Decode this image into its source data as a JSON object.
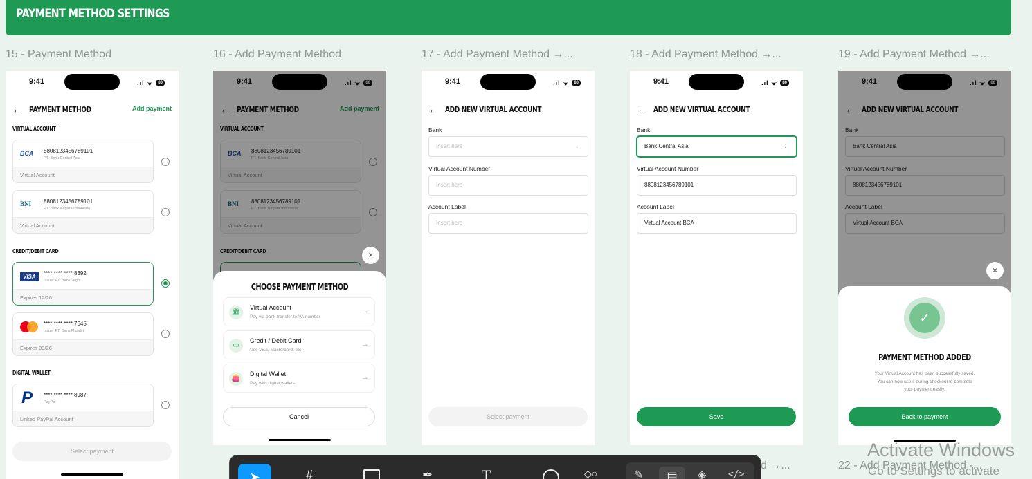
{
  "banner": {
    "title": "PAYMENT METHOD SETTINGS"
  },
  "frames": {
    "f15": {
      "label": "15 - Payment Method"
    },
    "f16": {
      "label": "16 - Add Payment Method"
    },
    "f17": {
      "label": "17 - Add Payment Method →..."
    },
    "f18": {
      "label": "18 - Add Payment Method →..."
    },
    "f19": {
      "label": "19 - Add Payment Method →..."
    },
    "f21": {
      "label": "d →..."
    },
    "f22": {
      "label": "22 - Add Payment Method -..."
    }
  },
  "status": {
    "time": "9:41",
    "signal": ".ıl ᯤ",
    "battery": "80"
  },
  "screen15": {
    "back": "←",
    "title": "PAYMENT METHOD",
    "action": "Add payment",
    "section_va": "VIRTUAL ACCOUNT",
    "section_card": "CREDIT/DEBIT CARD",
    "section_wallet": "DIGITAL WALLET",
    "cards": [
      {
        "logo": "BCA",
        "number": "8808123456789101",
        "sub": "PT. Bank Central Asia",
        "footer": "Virtual Account"
      },
      {
        "logo": "BNI",
        "number": "8808123456789101",
        "sub": "PT. Bank Negara Indonesia",
        "footer": "Virtual Account"
      },
      {
        "logo": "VISA",
        "number": "**** **** **** 8392",
        "sub": "Issuer PT. Bank Jago",
        "footer": "Expires 12/26"
      },
      {
        "logo": "mastercard",
        "number": "**** **** **** 7645",
        "sub": "Issuer PT. Bank Mandiri",
        "footer": "Expires 09/26"
      },
      {
        "logo": "P",
        "number": "**** **** **** 8987",
        "sub": "PayPal",
        "footer": "Linked PayPal Account"
      }
    ],
    "button": "Select payment"
  },
  "screen16": {
    "sheet_title": "CHOOSE PAYMENT METHOD",
    "close": "×",
    "options": [
      {
        "name": "Virtual Account",
        "desc": "Pay via bank transfer to VA number",
        "icon": "🏛"
      },
      {
        "name": "Credit / Debit Card",
        "desc": "Use Visa, Mastercard, etc.",
        "icon": "▭"
      },
      {
        "name": "Digital Wallet",
        "desc": "Pay with digital wallets",
        "icon": "👛"
      }
    ],
    "arrow": "→",
    "cancel": "Cancel"
  },
  "screen17": {
    "title": "ADD NEW VIRTUAL ACCOUNT",
    "bank_label": "Bank",
    "bank_placeholder": "Insert here",
    "va_label": "Virtual Account Number",
    "va_placeholder": "Insert here",
    "acc_label": "Account Label",
    "acc_placeholder": "Insert here",
    "button": "Select payment",
    "chevron": "⌄"
  },
  "screen18": {
    "title": "ADD NEW VIRTUAL ACCOUNT",
    "bank_label": "Bank",
    "bank_value": "Bank Central Asia",
    "va_label": "Virtual Account Number",
    "va_value": "8808123456789101",
    "acc_label": "Account Label",
    "acc_value": "Virtual Account BCA",
    "button": "Save"
  },
  "screen19": {
    "title": "ADD NEW VIRTUAL ACCOUNT",
    "success_title": "PAYMENT METHOD ADDED",
    "success_line1": "Your Virtual Account has been successfully saved.",
    "success_line2": "You can now use it during checkout to complete",
    "success_line3": "your payment easily.",
    "button": "Back to payment",
    "check": "✓"
  },
  "toolbar": {
    "tools": [
      "move-tool",
      "frame-tool",
      "rectangle-tool",
      "pen-tool",
      "text-tool",
      "ellipse-tool",
      "components-tool"
    ],
    "right_tools": [
      "draw-tool",
      "design-mode",
      "dev-mode",
      "code-tool"
    ]
  },
  "watermark": {
    "line1": "Activate Windows",
    "line2": "Go to Settings to activate"
  },
  "colors": {
    "brand_green": "#1e9a55",
    "background": "#eaf3ed"
  }
}
